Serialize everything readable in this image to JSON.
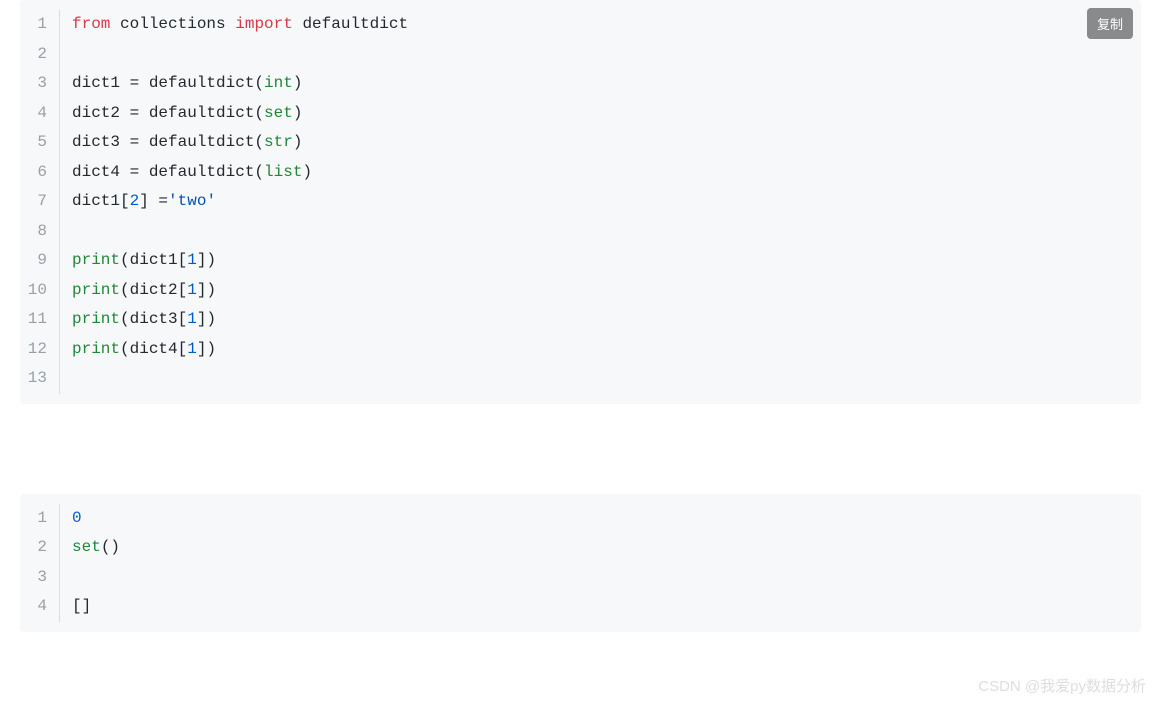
{
  "copy_button_label": "复制",
  "watermark": "CSDN @我爱py数据分析",
  "code_block_1": {
    "line_numbers": [
      "1",
      "2",
      "3",
      "4",
      "5",
      "6",
      "7",
      "8",
      "9",
      "10",
      "11",
      "12",
      "13"
    ],
    "tokens": [
      [
        {
          "t": "from",
          "c": "kw"
        },
        {
          "t": " collections ",
          "c": ""
        },
        {
          "t": "import",
          "c": "kw"
        },
        {
          "t": " defaultdict",
          "c": ""
        }
      ],
      [],
      [
        {
          "t": "dict1 = defaultdict(",
          "c": ""
        },
        {
          "t": "int",
          "c": "fn"
        },
        {
          "t": ")",
          "c": ""
        }
      ],
      [
        {
          "t": "dict2 = defaultdict(",
          "c": ""
        },
        {
          "t": "set",
          "c": "fn"
        },
        {
          "t": ")",
          "c": ""
        }
      ],
      [
        {
          "t": "dict3 = defaultdict(",
          "c": ""
        },
        {
          "t": "str",
          "c": "fn"
        },
        {
          "t": ")",
          "c": ""
        }
      ],
      [
        {
          "t": "dict4 = defaultdict(",
          "c": ""
        },
        {
          "t": "list",
          "c": "fn"
        },
        {
          "t": ")",
          "c": ""
        }
      ],
      [
        {
          "t": "dict1[",
          "c": ""
        },
        {
          "t": "2",
          "c": "num"
        },
        {
          "t": "] =",
          "c": ""
        },
        {
          "t": "'two'",
          "c": "str"
        }
      ],
      [],
      [
        {
          "t": "print",
          "c": "fn"
        },
        {
          "t": "(dict1[",
          "c": ""
        },
        {
          "t": "1",
          "c": "num"
        },
        {
          "t": "])",
          "c": ""
        }
      ],
      [
        {
          "t": "print",
          "c": "fn"
        },
        {
          "t": "(dict2[",
          "c": ""
        },
        {
          "t": "1",
          "c": "num"
        },
        {
          "t": "])",
          "c": ""
        }
      ],
      [
        {
          "t": "print",
          "c": "fn"
        },
        {
          "t": "(dict3[",
          "c": ""
        },
        {
          "t": "1",
          "c": "num"
        },
        {
          "t": "])",
          "c": ""
        }
      ],
      [
        {
          "t": "print",
          "c": "fn"
        },
        {
          "t": "(dict4[",
          "c": ""
        },
        {
          "t": "1",
          "c": "num"
        },
        {
          "t": "])",
          "c": ""
        }
      ],
      []
    ]
  },
  "code_block_2": {
    "line_numbers": [
      "1",
      "2",
      "3",
      "4"
    ],
    "tokens": [
      [
        {
          "t": "0",
          "c": "num"
        }
      ],
      [
        {
          "t": "set",
          "c": "fn"
        },
        {
          "t": "()",
          "c": ""
        }
      ],
      [],
      [
        {
          "t": "[]",
          "c": ""
        }
      ]
    ]
  }
}
